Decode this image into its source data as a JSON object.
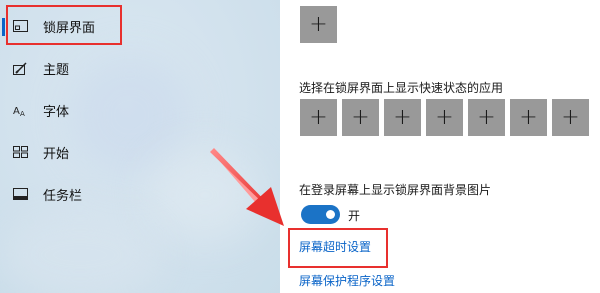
{
  "sidebar": {
    "items": [
      {
        "label": "锁屏界面",
        "icon": "lock-screen-icon"
      },
      {
        "label": "主题",
        "icon": "theme-brush-icon"
      },
      {
        "label": "字体",
        "icon": "font-icon"
      },
      {
        "label": "开始",
        "icon": "start-icon"
      },
      {
        "label": "任务栏",
        "icon": "taskbar-icon"
      }
    ],
    "active_index": 0
  },
  "main": {
    "quick_status_label": "选择在锁屏界面上显示快速状态的应用",
    "plus_symbol": "+",
    "background_label": "在登录屏幕上显示锁屏界面背景图片",
    "toggle": {
      "state": "on",
      "label": "开"
    },
    "links": {
      "screen_timeout": "屏幕超时设置",
      "screen_saver": "屏幕保护程序设置"
    }
  },
  "colors": {
    "accent": "#0a64c8",
    "annotation_red": "#e8302e",
    "tile_gray": "#999999"
  }
}
